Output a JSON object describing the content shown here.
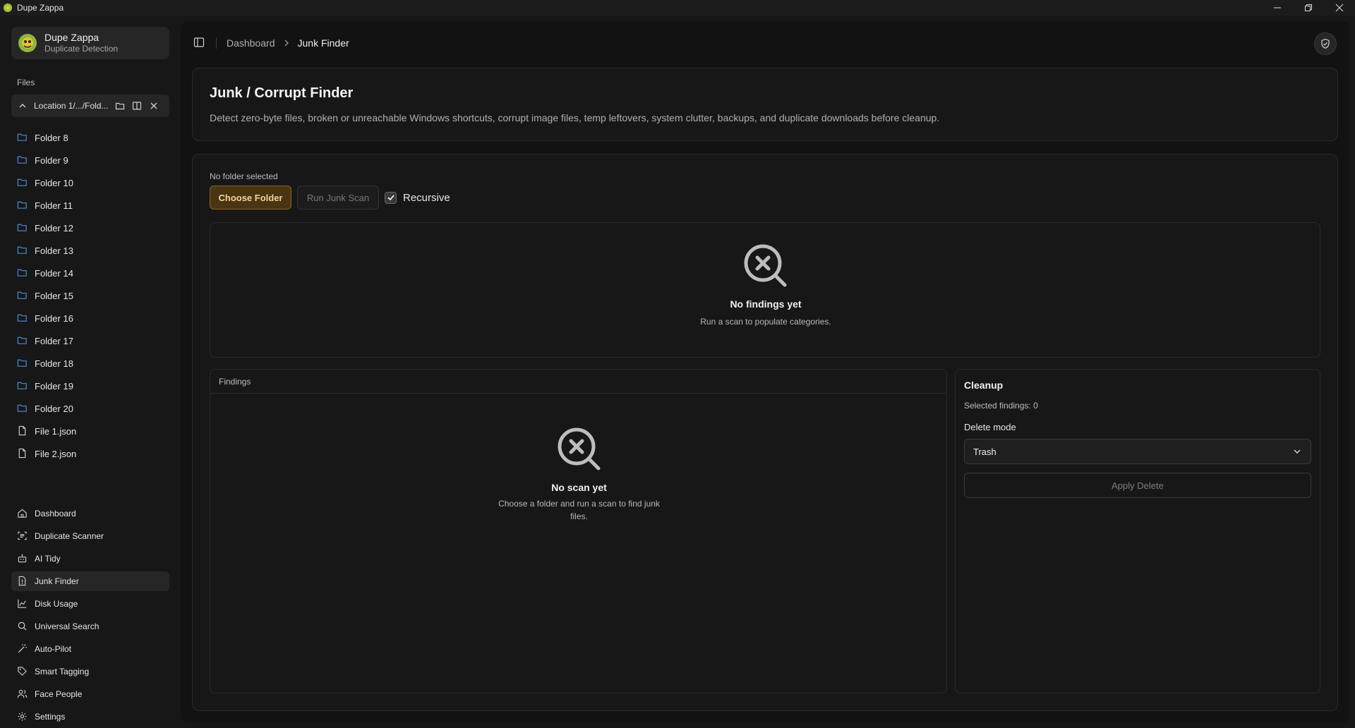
{
  "window": {
    "title": "Dupe Zappa"
  },
  "brand": {
    "name": "Dupe Zappa",
    "subtitle": "Duplicate Detection"
  },
  "sidebar": {
    "files_label": "Files",
    "location_label": "Location 1/.../Fold...",
    "tree": [
      {
        "label": "Folder 8",
        "icon": "folder-icon"
      },
      {
        "label": "Folder 9",
        "icon": "folder-icon"
      },
      {
        "label": "Folder 10",
        "icon": "folder-icon"
      },
      {
        "label": "Folder 11",
        "icon": "folder-icon"
      },
      {
        "label": "Folder 12",
        "icon": "folder-icon"
      },
      {
        "label": "Folder 13",
        "icon": "folder-icon"
      },
      {
        "label": "Folder 14",
        "icon": "folder-icon"
      },
      {
        "label": "Folder 15",
        "icon": "folder-icon"
      },
      {
        "label": "Folder 16",
        "icon": "folder-icon"
      },
      {
        "label": "Folder 17",
        "icon": "folder-icon"
      },
      {
        "label": "Folder 18",
        "icon": "folder-icon"
      },
      {
        "label": "Folder 19",
        "icon": "folder-icon"
      },
      {
        "label": "Folder 20",
        "icon": "folder-icon"
      },
      {
        "label": "File 1.json",
        "icon": "file-icon"
      },
      {
        "label": "File 2.json",
        "icon": "file-icon"
      }
    ],
    "nav": [
      {
        "label": "Dashboard",
        "icon": "home-icon",
        "active": false
      },
      {
        "label": "Duplicate Scanner",
        "icon": "scan-icon",
        "active": false
      },
      {
        "label": "AI Tidy",
        "icon": "bot-icon",
        "active": false
      },
      {
        "label": "Junk Finder",
        "icon": "file-alert-icon",
        "active": true
      },
      {
        "label": "Disk Usage",
        "icon": "chart-icon",
        "active": false
      },
      {
        "label": "Universal Search",
        "icon": "search-icon",
        "active": false
      },
      {
        "label": "Auto-Pilot",
        "icon": "wand-icon",
        "active": false
      },
      {
        "label": "Smart Tagging",
        "icon": "tag-icon",
        "active": false
      },
      {
        "label": "Face People",
        "icon": "users-icon",
        "active": false
      },
      {
        "label": "Settings",
        "icon": "gear-icon",
        "active": false
      }
    ]
  },
  "breadcrumb": {
    "parent": "Dashboard",
    "current": "Junk Finder"
  },
  "header": {
    "title": "Junk / Corrupt Finder",
    "description": "Detect zero-byte files, broken or unreachable Windows shortcuts, corrupt image files, temp leftovers, system clutter, backups, and duplicate downloads before cleanup."
  },
  "scan": {
    "folder_status": "No folder selected",
    "choose_folder": "Choose Folder",
    "run_scan": "Run Junk Scan",
    "recursive_label": "Recursive",
    "recursive_checked": true
  },
  "categories": {
    "empty_title": "No findings yet",
    "empty_sub": "Run a scan to populate categories."
  },
  "findings": {
    "header": "Findings",
    "empty_title": "No scan yet",
    "empty_sub_line1": "Choose a folder and run a scan to find junk",
    "empty_sub_line2": "files."
  },
  "cleanup": {
    "title": "Cleanup",
    "selected_label": "Selected findings: 0",
    "delete_mode_label": "Delete mode",
    "delete_mode_value": "Trash",
    "apply_label": "Apply Delete"
  },
  "colors": {
    "accent": "#f6d399",
    "accent_bg": "#4a3512",
    "background": "#171717"
  }
}
